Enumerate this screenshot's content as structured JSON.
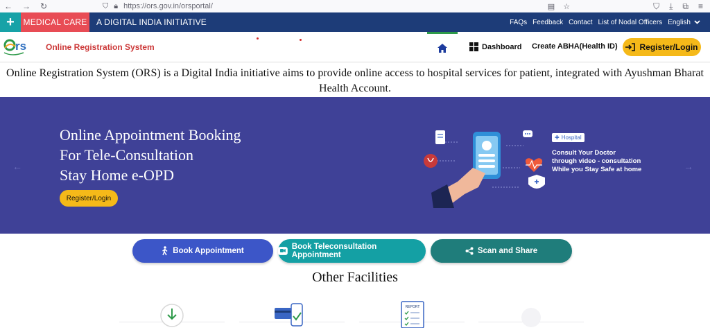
{
  "browser": {
    "url": "https://ors.gov.in/orsportal/"
  },
  "topbar": {
    "plus_icon": "plus-icon",
    "medical_care": "MEDICAL CARE",
    "initiative": "A DIGITAL INDIA INITIATIVE",
    "links": [
      "FAQs",
      "Feedback",
      "Contact",
      "List of Nodal Officers"
    ],
    "language": "English",
    "colors": {
      "bar": "#1d3c78",
      "plus": "#17a2a7",
      "medical": "#e84c55"
    }
  },
  "header": {
    "title": "Online Registration System",
    "nav": {
      "home_icon": "home-icon",
      "dashboard": "Dashboard",
      "abha": "Create ABHA(Health ID)",
      "register_login": "Register/Login"
    }
  },
  "intro": {
    "text": "Online Registration System (ORS) is a Digital India initiative aims to provide online access to hospital services for patient, integrated with Ayushman Bharat Health Account."
  },
  "banner": {
    "line1": "Online Appointment Booking",
    "line2": "For Tele-Consultation",
    "line3": "Stay Home e-OPD",
    "button": "Register/Login",
    "hospital_label": "Hospital",
    "consult_line1": "Consult Your Doctor",
    "consult_line2": "through video - consultation",
    "consult_line3": "While you Stay Safe at home",
    "background": "#3f4197"
  },
  "actions": {
    "book": "Book Appointment",
    "tele": "Book Teleconsultation Appointment",
    "scan": "Scan and Share"
  },
  "facilities": {
    "heading": "Other Facilities",
    "report_label": "REPORT"
  }
}
